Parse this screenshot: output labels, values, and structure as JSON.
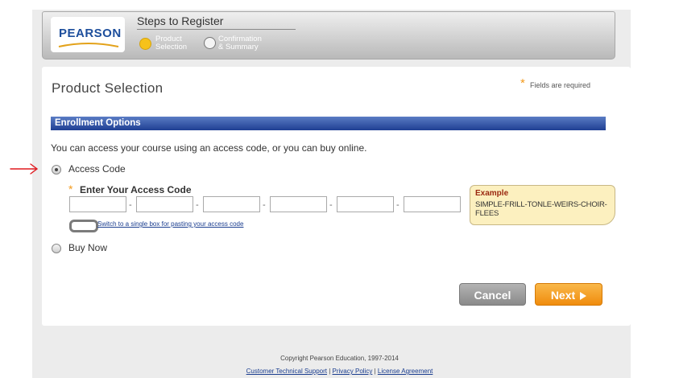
{
  "header": {
    "logo": "PEARSON",
    "steps_title": "Steps to Register",
    "steps": [
      {
        "line1": "Product",
        "line2": "Selection"
      },
      {
        "line1": "Confirmation",
        "line2": "& Summary"
      }
    ]
  },
  "page": {
    "title": "Product Selection",
    "required_star": "*",
    "required_note": "Fields are required"
  },
  "enrollment": {
    "section_title": "Enrollment Options",
    "intro": "You can access your course using an access code, or you can buy online.",
    "option_access_code": "Access Code",
    "option_buy_now": "Buy Now",
    "code_label": "Enter Your Access Code",
    "switch_link": "Switch to a single box for pasting your access code",
    "example_title": "Example",
    "example_code": "SIMPLE-FRILL-TONLE-WEIRS-CHOIR-FLEES"
  },
  "buttons": {
    "cancel": "Cancel",
    "next": "Next"
  },
  "footer": {
    "copyright": "Copyright Pearson Education, 1997-2014",
    "links": [
      "Customer Technical Support",
      "Privacy Policy",
      "License Agreement"
    ],
    "separator": "|"
  },
  "colors": {
    "accent_orange": "#f08c0d",
    "section_blue": "#1f3f93",
    "annotation_red": "#e0191f"
  }
}
